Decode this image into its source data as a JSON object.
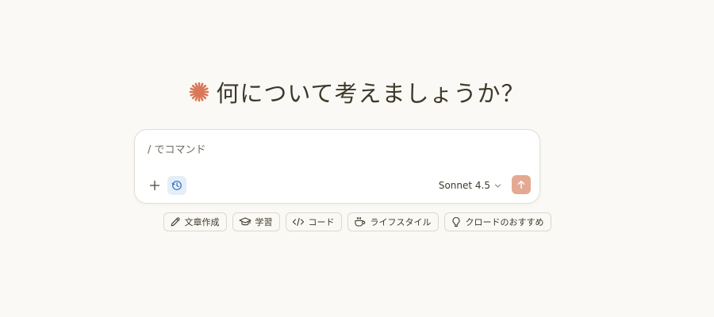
{
  "greeting": {
    "title": "何について考えましょうか？",
    "logo_icon": "claude-starburst-icon",
    "logo_color": "#d97757"
  },
  "composer": {
    "placeholder": "/ でコマンド",
    "value": "",
    "add_icon": "plus-icon",
    "history_icon": "clock-icon",
    "model_label": "Sonnet 4.5",
    "model_icon": "chevron-down-icon",
    "send_icon": "arrow-up-icon",
    "send_color": "#e3a992"
  },
  "chips": [
    {
      "label": "文章作成",
      "icon": "pencil-icon"
    },
    {
      "label": "学習",
      "icon": "graduation-cap-icon"
    },
    {
      "label": "コード",
      "icon": "code-icon"
    },
    {
      "label": "ライフスタイル",
      "icon": "coffee-cup-icon"
    },
    {
      "label": "クロードのおすすめ",
      "icon": "lightbulb-icon"
    }
  ]
}
